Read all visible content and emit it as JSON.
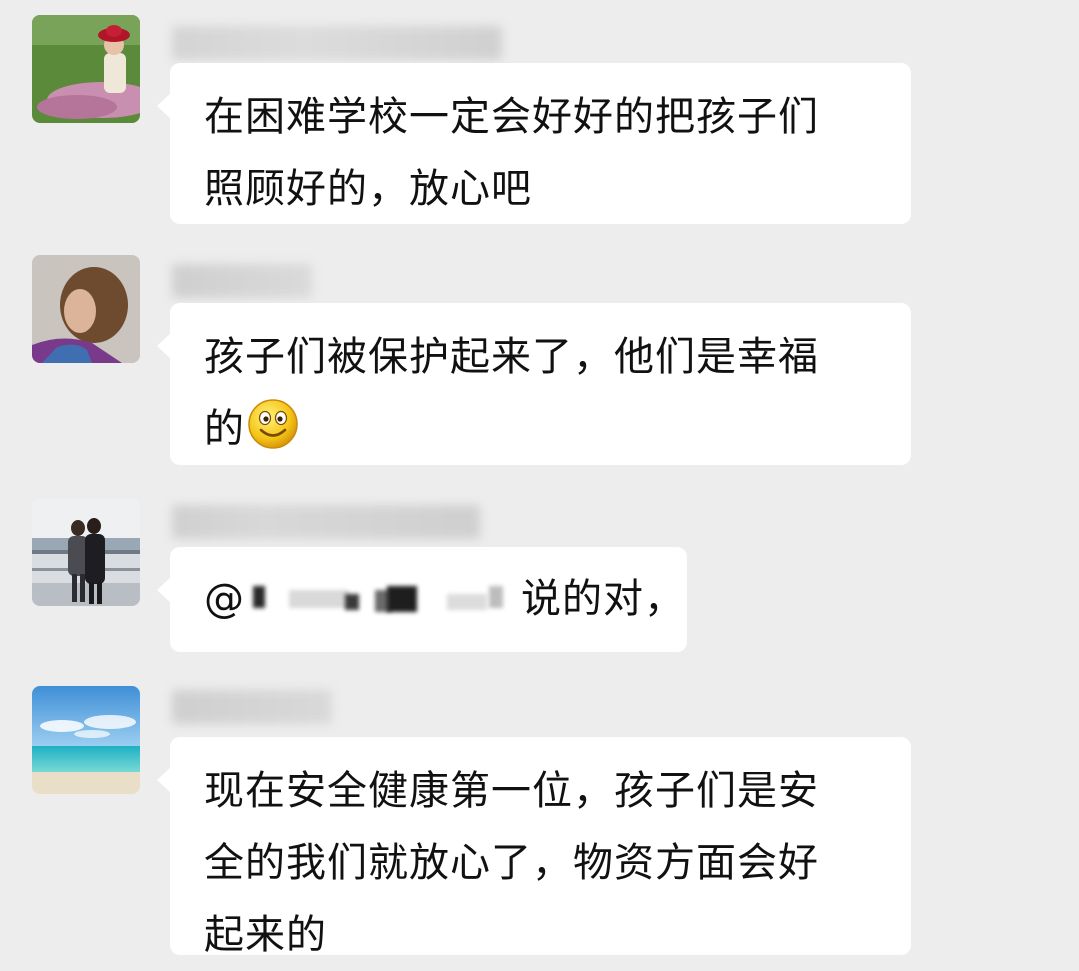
{
  "colors": {
    "background": "#ededed",
    "bubble": "#ffffff",
    "text": "#111111"
  },
  "messages": [
    {
      "avatar": "woman-red-hat-avatar",
      "sender": "",
      "lines": [
        "在困难学校一定会好好的把孩子们",
        "照顾好的，放心吧"
      ]
    },
    {
      "avatar": "woman-short-hair-avatar",
      "sender": "",
      "lines": [
        "孩子们被保护起来了，他们是幸福",
        "的"
      ],
      "emoji": "smile-emoji"
    },
    {
      "avatar": "couple-waterfront-avatar",
      "sender": "",
      "mention_prefix": "@",
      "text": "说的对，"
    },
    {
      "avatar": "beach-sky-avatar",
      "sender": "",
      "lines": [
        "现在安全健康第一位，孩子们是安",
        "全的我们就放心了，物资方面会好",
        "起来的"
      ]
    }
  ]
}
